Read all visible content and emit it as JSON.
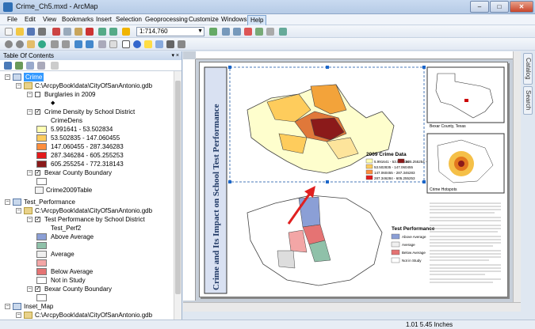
{
  "window": {
    "title": "Crime_Ch5.mxd - ArcMap",
    "minimize": "–",
    "maximize": "□",
    "close": "✕"
  },
  "menu": [
    "File",
    "Edit",
    "View",
    "Bookmarks",
    "Insert",
    "Selection",
    "Geoprocessing",
    "Customize",
    "Windows",
    "Help"
  ],
  "toolbar": {
    "scale": "1:714,760"
  },
  "toc": {
    "title": "Table Of Contents",
    "header_btns": "▾ ×",
    "crime": {
      "name": "Crime",
      "db_path": "C:\\ArcpyBook\\data\\CityOfSanAntonio.gdb",
      "burglaries": "Burglaries in 2009",
      "density_layer": "Crime Density by School District",
      "density_field": "CrimeDens",
      "classes": [
        {
          "label": "5.991641 - 53.502834",
          "color": "#ffffb2"
        },
        {
          "label": "53.502835 - 147.060455",
          "color": "#fecc5c"
        },
        {
          "label": "147.060455 - 287.346283",
          "color": "#fd8d3c"
        },
        {
          "label": "287.346284 - 605.255253",
          "color": "#e31a1c"
        },
        {
          "label": "605.255254 - 772.318143",
          "color": "#8b1a1a"
        }
      ],
      "boundary": "Bexar County Boundary",
      "table": "Crime2009Table"
    },
    "test": {
      "name": "Test_Performance",
      "db_path": "C:\\ArcpyBook\\data\\CityOfSanAntonio.gdb",
      "layer": "Test Performance by School District",
      "field": "Test_Perf2",
      "classes": [
        {
          "label": "Above Average",
          "color": "#8b9fd6"
        },
        {
          "label": "",
          "color": "#8fc1a9"
        },
        {
          "label": "Average",
          "color": "#f0f0f0"
        },
        {
          "label": "",
          "color": "#f3a6a6"
        },
        {
          "label": "Below Average",
          "color": "#e57373"
        },
        {
          "label": "Not in Study",
          "color": "#ffffff"
        }
      ],
      "boundary": "Bexar County Boundary"
    },
    "inset": {
      "name": "Inset_Map",
      "db_path": "C:\\ArcpyBook\\data\\CityOfSanAntonio.gdb"
    }
  },
  "layout": {
    "side_title": "Crime and Its Impact on School Test Performance",
    "crime_legend_title": "2009 Crime Data",
    "crime_legend_items": [
      "5.991641 - 53.502834",
      "53.502835 - 147.060455",
      "147.060455 - 287.346283",
      "287.346284 - 605.255253",
      "605.255254 - 772.318143"
    ],
    "test_legend_title": "Test Performance",
    "test_legend_items": [
      "Above Average",
      "Average",
      "Below Average",
      "Not in Study"
    ],
    "texas_caption": "Bexar County, Texas",
    "hotspot_caption": "Crime Hotspots"
  },
  "side_tabs": [
    "Catalog",
    "Search"
  ],
  "status": {
    "coords": "1.01  5.45 Inches"
  }
}
